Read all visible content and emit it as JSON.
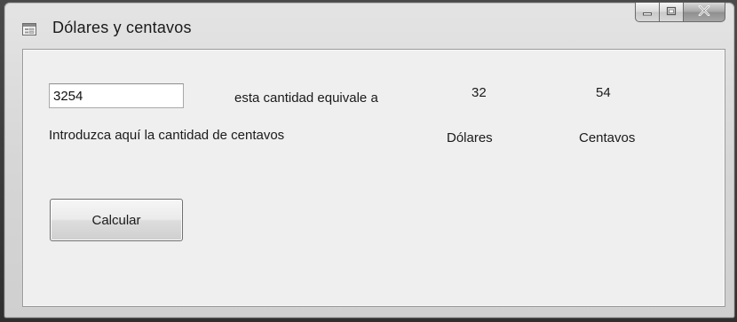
{
  "window": {
    "title": "Dólares y centavos",
    "icon": "form-icon"
  },
  "caption_buttons": {
    "minimize_icon": "minimize-icon",
    "maximize_icon": "maximize-icon",
    "close_icon": "close-icon"
  },
  "form": {
    "cents_input_value": "3254",
    "equivalence_label": "esta cantidad equivale a",
    "dollars_value": "32",
    "cents_value": "54",
    "instruction_label": "Introduzca aquí la cantidad de centavos",
    "dollars_label": "Dólares",
    "cents_label": "Centavos",
    "calculate_button": "Calcular"
  }
}
